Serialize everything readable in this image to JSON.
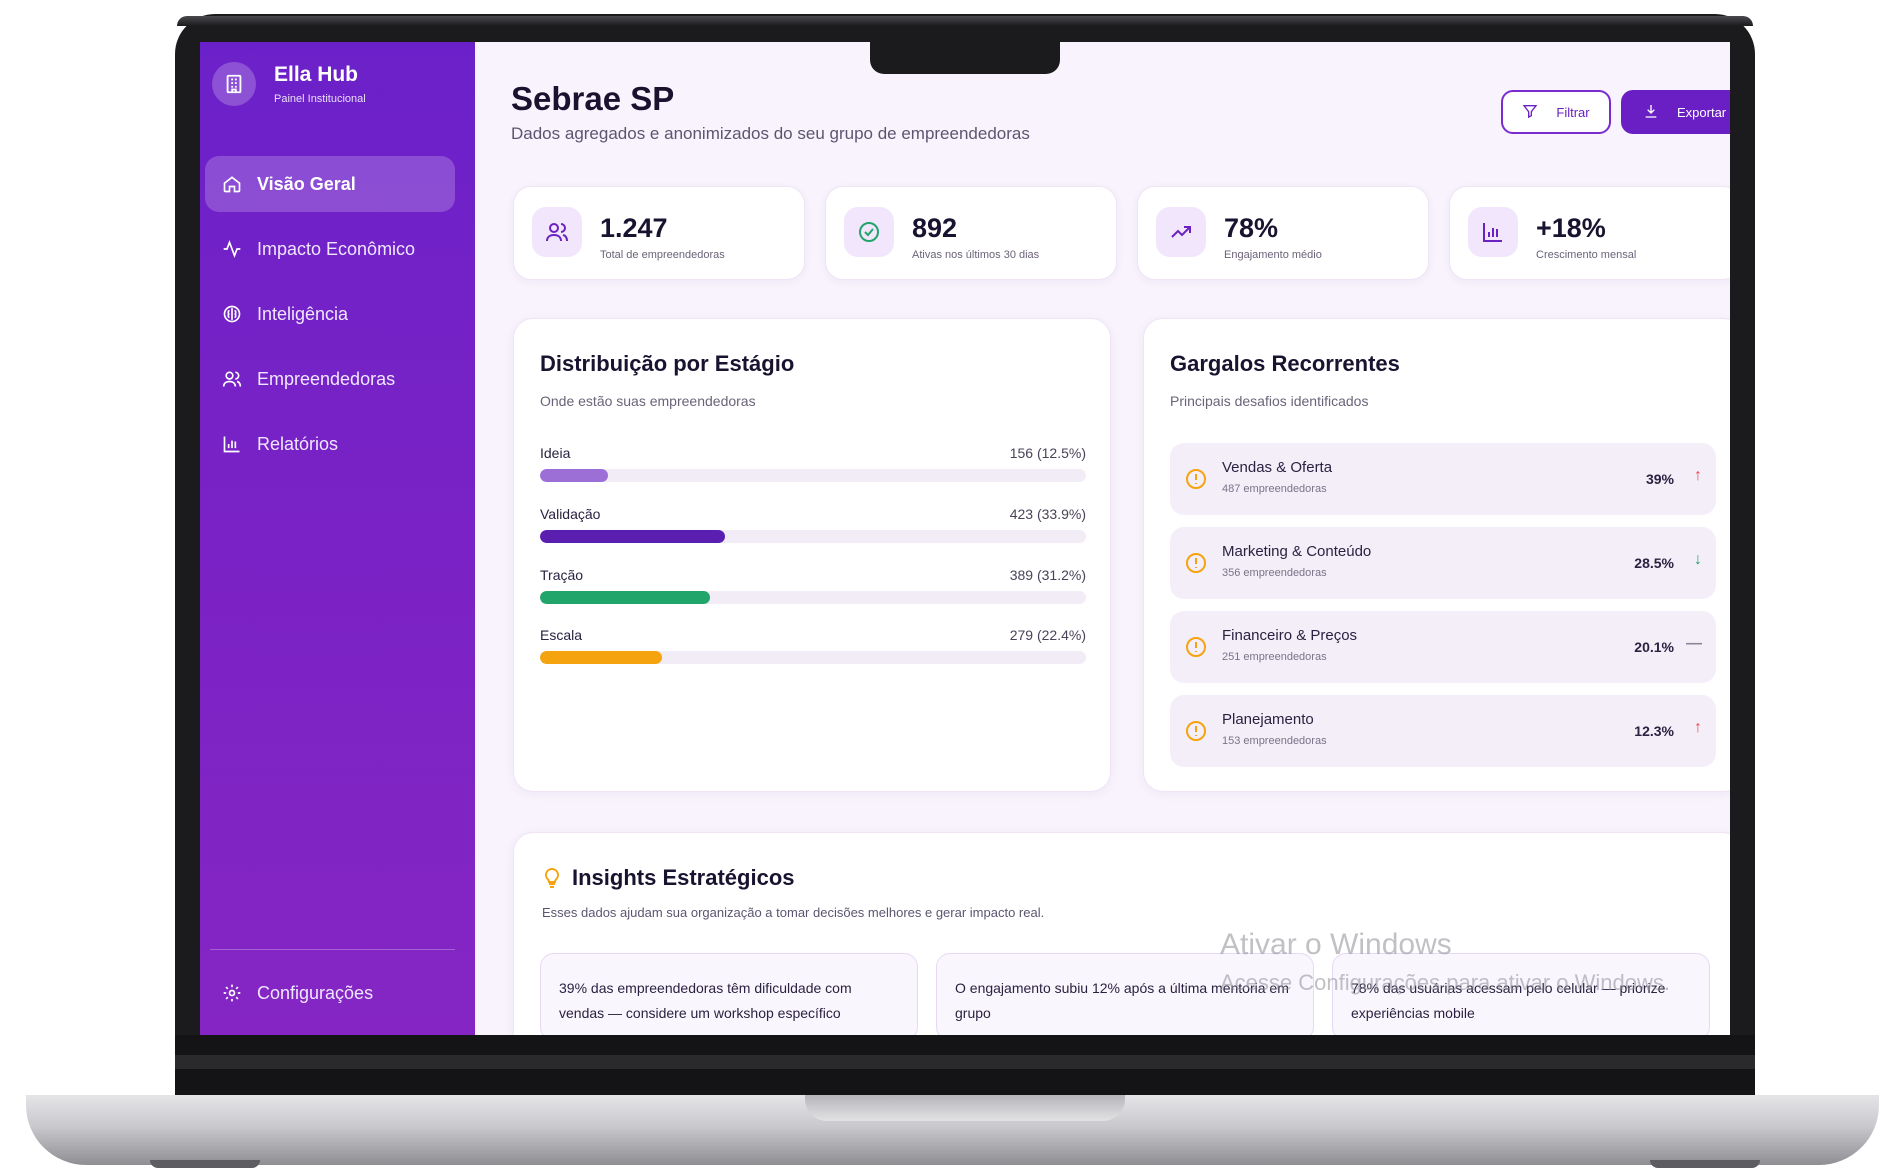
{
  "brand": {
    "name": "Ella Hub",
    "subtitle": "Painel Institucional"
  },
  "nav": {
    "items": [
      {
        "label": "Visão Geral",
        "icon": "home-icon",
        "active": true
      },
      {
        "label": "Impacto Econômico",
        "icon": "activity-icon"
      },
      {
        "label": "Inteligência",
        "icon": "brain-icon"
      },
      {
        "label": "Empreendedoras",
        "icon": "users-icon"
      },
      {
        "label": "Relatórios",
        "icon": "bar-chart-icon"
      }
    ],
    "settings_label": "Configurações"
  },
  "header": {
    "title": "Sebrae SP",
    "subtitle": "Dados agregados e anonimizados do seu grupo de empreendedoras",
    "filter_label": "Filtrar",
    "export_label": "Exportar"
  },
  "stats": [
    {
      "value": "1.247",
      "label": "Total de empreendedoras",
      "icon": "users-icon"
    },
    {
      "value": "892",
      "label": "Ativas nos últimos 30 dias",
      "icon": "check-circle-icon"
    },
    {
      "value": "78%",
      "label": "Engajamento médio",
      "icon": "trending-up-icon"
    },
    {
      "value": "+18%",
      "label": "Crescimento mensal",
      "icon": "bar-chart-icon"
    }
  ],
  "distribution": {
    "title": "Distribuição por Estágio",
    "subtitle": "Onde estão suas empreendedoras",
    "stages": [
      {
        "label": "Ideia",
        "count": "156 (12.5%)",
        "percent": 12.5,
        "color": "#9b6fd6"
      },
      {
        "label": "Validação",
        "count": "423 (33.9%)",
        "percent": 33.9,
        "color": "#5a1fb0"
      },
      {
        "label": "Tração",
        "count": "389 (31.2%)",
        "percent": 31.2,
        "color": "#22a56b"
      },
      {
        "label": "Escala",
        "count": "279 (22.4%)",
        "percent": 22.4,
        "color": "#f5a30f"
      }
    ]
  },
  "bottlenecks": {
    "title": "Gargalos Recorrentes",
    "subtitle": "Principais desafios identificados",
    "items": [
      {
        "name": "Vendas & Oferta",
        "count": "487 empreendedoras",
        "percent": "39%",
        "trend": "↑",
        "trend_color": "#ef4444"
      },
      {
        "name": "Marketing & Conteúdo",
        "count": "356 empreendedoras",
        "percent": "28.5%",
        "trend": "↓",
        "trend_color": "#22a56b"
      },
      {
        "name": "Financeiro & Preços",
        "count": "251 empreendedoras",
        "percent": "20.1%",
        "trend": "—",
        "trend_color": "#8a8496"
      },
      {
        "name": "Planejamento",
        "count": "153 empreendedoras",
        "percent": "12.3%",
        "trend": "↑",
        "trend_color": "#ef4444"
      }
    ]
  },
  "insights": {
    "title": "Insights Estratégicos",
    "subtitle": "Esses dados ajudam sua organização a tomar decisões melhores e gerar impacto real.",
    "items": [
      "39% das empreendedoras têm dificuldade com vendas — considere um workshop específico",
      "O engajamento subiu 12% após a última mentoria em grupo",
      "78% das usuárias acessam pelo celular — priorize experiências mobile"
    ]
  },
  "watermark": {
    "line1": "Ativar o Windows",
    "line2": "Acesse Configurações para ativar o Windows."
  },
  "colors": {
    "primary": "#6a1fc4",
    "sidebar": "#7a22c5",
    "warning": "#f5a30f"
  }
}
